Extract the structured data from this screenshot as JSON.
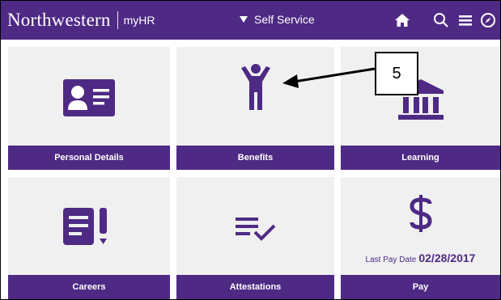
{
  "header": {
    "brand": "Northwestern",
    "brand_sub": "myHR",
    "menu_label": "Self Service",
    "background": "#4e2a84"
  },
  "tiles": [
    {
      "label": "Personal Details",
      "icon": "id-card-icon"
    },
    {
      "label": "Benefits",
      "icon": "person-arms-up-icon"
    },
    {
      "label": "Learning",
      "icon": "building-icon"
    },
    {
      "label": "Careers",
      "icon": "document-exclamation-icon"
    },
    {
      "label": "Attestations",
      "icon": "list-check-icon"
    },
    {
      "label": "Pay",
      "icon": "dollar-icon"
    }
  ],
  "pay": {
    "last_pay_label": "Last Pay Date",
    "last_pay_date": "02/28/2017"
  },
  "callout": {
    "number": "5"
  },
  "colors": {
    "accent": "#4e2a84",
    "tile_bg": "#f0f0f0"
  }
}
